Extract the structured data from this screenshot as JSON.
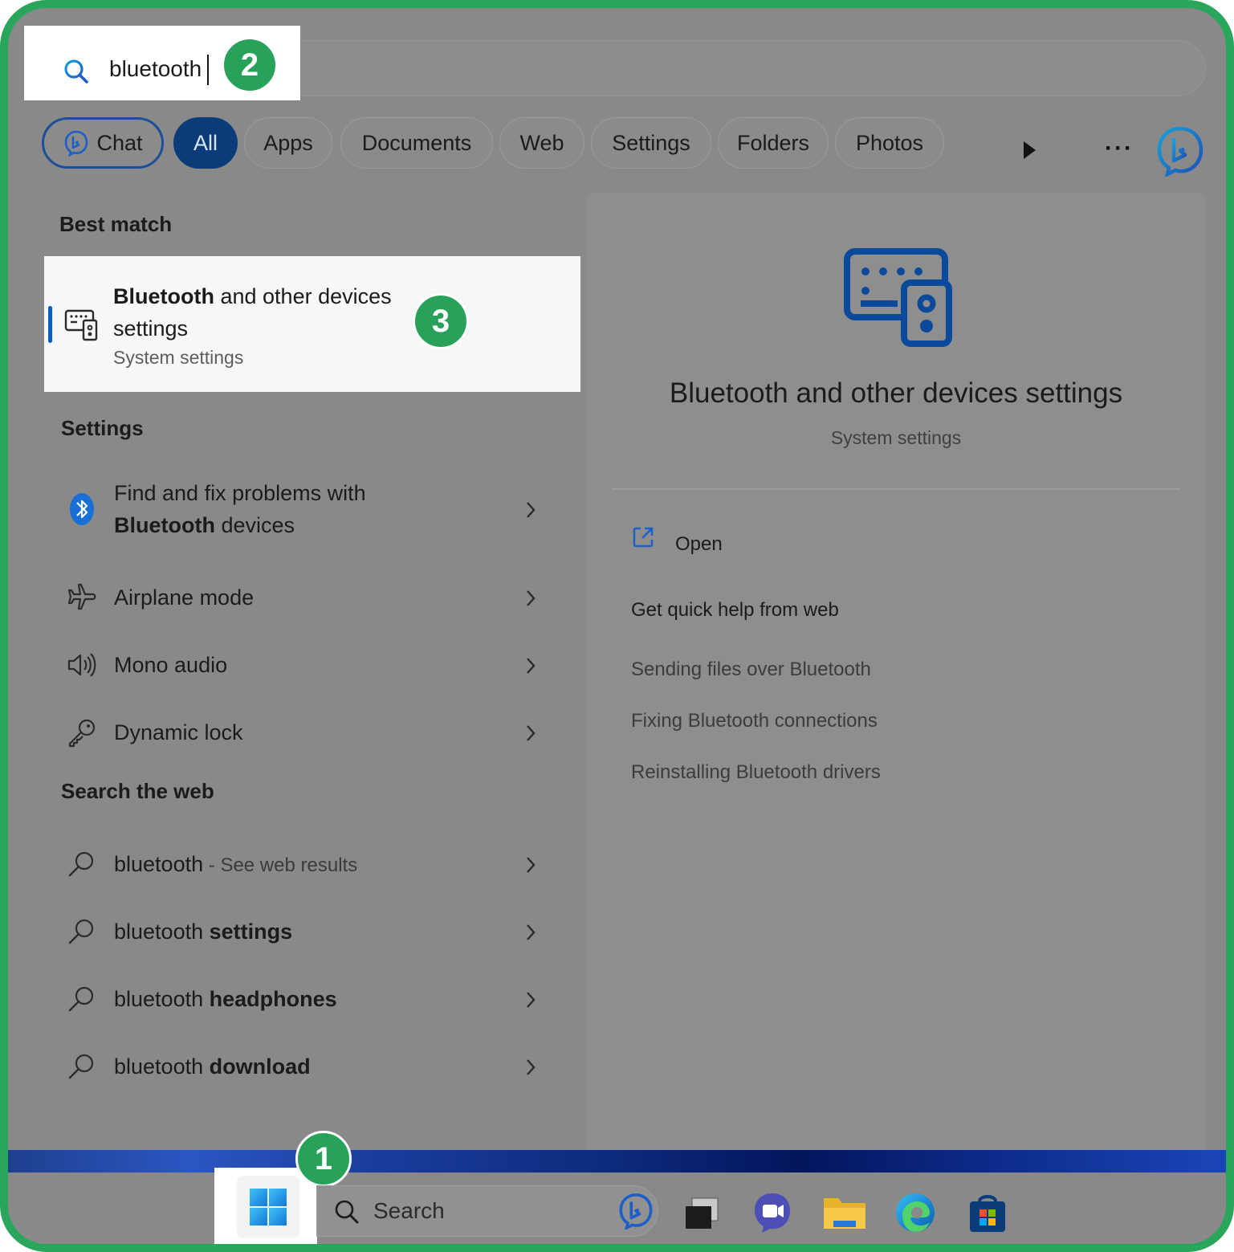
{
  "search": {
    "query": "bluetooth"
  },
  "badges": {
    "step1": "1",
    "step2": "2",
    "step3": "3"
  },
  "filters": [
    {
      "label": "Chat"
    },
    {
      "label": "All"
    },
    {
      "label": "Apps"
    },
    {
      "label": "Documents"
    },
    {
      "label": "Web"
    },
    {
      "label": "Settings"
    },
    {
      "label": "Folders"
    },
    {
      "label": "Photos"
    }
  ],
  "more_dots": "···",
  "best_match": {
    "heading": "Best match",
    "title_bold": "Bluetooth",
    "title_rest": " and other devices settings",
    "subtitle": "System settings"
  },
  "settings": {
    "heading": "Settings",
    "items": [
      {
        "label_pre": "Find and fix problems with ",
        "label_bold": "Bluetooth",
        "label_post": " devices"
      },
      {
        "label": "Airplane mode"
      },
      {
        "label": "Mono audio"
      },
      {
        "label": "Dynamic lock"
      }
    ]
  },
  "web": {
    "heading": "Search the web",
    "items": [
      {
        "plain": "bluetooth",
        "bold": "",
        "suffix": " - See web results"
      },
      {
        "plain": "bluetooth ",
        "bold": "settings",
        "suffix": ""
      },
      {
        "plain": "bluetooth ",
        "bold": "headphones",
        "suffix": ""
      },
      {
        "plain": "bluetooth ",
        "bold": "download",
        "suffix": ""
      }
    ]
  },
  "preview": {
    "title": "Bluetooth and other devices settings",
    "subtitle": "System settings",
    "open_label": "Open",
    "help_heading": "Get quick help from web",
    "help_links": [
      "Sending files over Bluetooth",
      "Fixing Bluetooth connections",
      "Reinstalling Bluetooth drivers"
    ]
  },
  "taskbar": {
    "search_label": "Search"
  },
  "colors": {
    "frame": "#2aa65c",
    "badge": "#28a25a",
    "accent": "#0a5dc2",
    "all_chip": "#0b3c79",
    "overlay": "#898989"
  }
}
